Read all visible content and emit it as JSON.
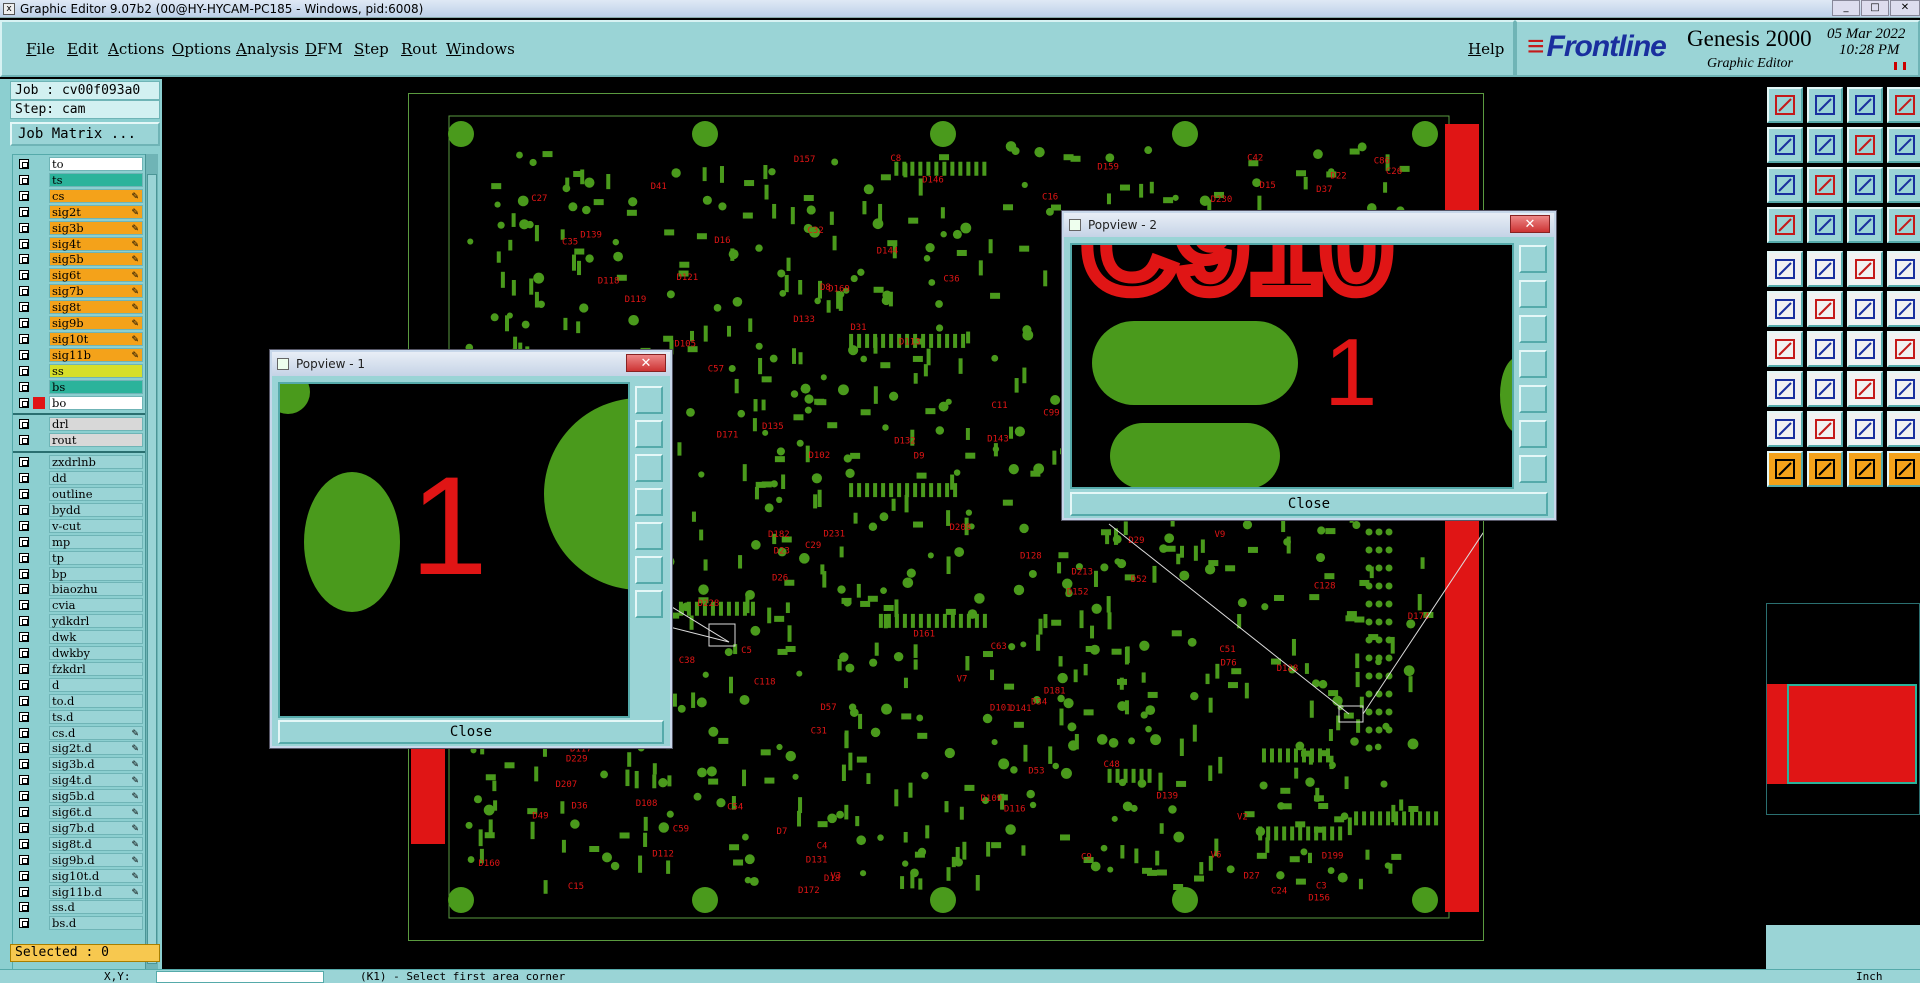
{
  "window": {
    "title": "Graphic Editor 9.07b2 (00@HY-HYCAM-PC185 - Windows, pid:6008)"
  },
  "menu": {
    "items": [
      "File",
      "Edit",
      "Actions",
      "Options",
      "Analysis",
      "DFM",
      "Step",
      "Rout",
      "Windows"
    ],
    "help": "Help"
  },
  "brand": {
    "logo": "Frontline",
    "product": "Genesis 2000",
    "subtitle": "Graphic Editor",
    "date": "05 Mar 2022",
    "time": "10:28 PM"
  },
  "job": {
    "job_line": "Job : cv00f093a0",
    "step_line": "Step: cam",
    "matrix_button": "Job Matrix ..."
  },
  "layers": [
    {
      "name": "to",
      "bg": "#ffffff",
      "lock": false,
      "mark": ""
    },
    {
      "name": "ts",
      "bg": "#2bb39b",
      "lock": false,
      "mark": ""
    },
    {
      "name": "cs",
      "bg": "#f4a21a",
      "lock": true,
      "mark": ""
    },
    {
      "name": "sig2t",
      "bg": "#f4a21a",
      "lock": true,
      "mark": ""
    },
    {
      "name": "sig3b",
      "bg": "#f4a21a",
      "lock": true,
      "mark": ""
    },
    {
      "name": "sig4t",
      "bg": "#f4a21a",
      "lock": true,
      "mark": ""
    },
    {
      "name": "sig5b",
      "bg": "#f4a21a",
      "lock": true,
      "mark": ""
    },
    {
      "name": "sig6t",
      "bg": "#f4a21a",
      "lock": true,
      "mark": ""
    },
    {
      "name": "sig7b",
      "bg": "#f4a21a",
      "lock": true,
      "mark": ""
    },
    {
      "name": "sig8t",
      "bg": "#f4a21a",
      "lock": true,
      "mark": ""
    },
    {
      "name": "sig9b",
      "bg": "#f4a21a",
      "lock": true,
      "mark": ""
    },
    {
      "name": "sig10t",
      "bg": "#f4a21a",
      "lock": true,
      "mark": ""
    },
    {
      "name": "sig11b",
      "bg": "#f4a21a",
      "lock": true,
      "mark": ""
    },
    {
      "name": "ss",
      "bg": "#d6df2a",
      "lock": false,
      "mark": ""
    },
    {
      "name": "bs",
      "bg": "#2bb39b",
      "lock": false,
      "mark": ""
    },
    {
      "name": "bo",
      "bg": "#ffffff",
      "lock": false,
      "mark": "red"
    },
    {
      "sep": true
    },
    {
      "name": "drl",
      "bg": "#d8d8d8",
      "lock": false,
      "mark": ""
    },
    {
      "name": "rout",
      "bg": "#d8d8d8",
      "lock": false,
      "mark": ""
    },
    {
      "sep": true
    },
    {
      "name": "zxdrlnb",
      "bg": "#9ad4d6",
      "lock": false,
      "mark": ""
    },
    {
      "name": "dd",
      "bg": "#9ad4d6",
      "lock": false,
      "mark": ""
    },
    {
      "name": "outline",
      "bg": "#9ad4d6",
      "lock": false,
      "mark": ""
    },
    {
      "name": "bydd",
      "bg": "#9ad4d6",
      "lock": false,
      "mark": ""
    },
    {
      "name": "v-cut",
      "bg": "#9ad4d6",
      "lock": false,
      "mark": ""
    },
    {
      "name": "mp",
      "bg": "#9ad4d6",
      "lock": false,
      "mark": ""
    },
    {
      "name": "tp",
      "bg": "#9ad4d6",
      "lock": false,
      "mark": ""
    },
    {
      "name": "bp",
      "bg": "#9ad4d6",
      "lock": false,
      "mark": ""
    },
    {
      "name": "biaozhu",
      "bg": "#9ad4d6",
      "lock": false,
      "mark": ""
    },
    {
      "name": "cvia",
      "bg": "#9ad4d6",
      "lock": false,
      "mark": ""
    },
    {
      "name": "ydkdrl",
      "bg": "#9ad4d6",
      "lock": false,
      "mark": ""
    },
    {
      "name": "dwk",
      "bg": "#9ad4d6",
      "lock": false,
      "mark": ""
    },
    {
      "name": "dwkby",
      "bg": "#9ad4d6",
      "lock": false,
      "mark": ""
    },
    {
      "name": "fzkdrl",
      "bg": "#9ad4d6",
      "lock": false,
      "mark": ""
    },
    {
      "name": "d",
      "bg": "#9ad4d6",
      "lock": false,
      "mark": ""
    },
    {
      "name": "to.d",
      "bg": "#9ad4d6",
      "lock": false,
      "mark": ""
    },
    {
      "name": "ts.d",
      "bg": "#9ad4d6",
      "lock": false,
      "mark": ""
    },
    {
      "name": "cs.d",
      "bg": "#9ad4d6",
      "lock": true,
      "mark": ""
    },
    {
      "name": "sig2t.d",
      "bg": "#9ad4d6",
      "lock": true,
      "mark": ""
    },
    {
      "name": "sig3b.d",
      "bg": "#9ad4d6",
      "lock": true,
      "mark": ""
    },
    {
      "name": "sig4t.d",
      "bg": "#9ad4d6",
      "lock": true,
      "mark": ""
    },
    {
      "name": "sig5b.d",
      "bg": "#9ad4d6",
      "lock": true,
      "mark": ""
    },
    {
      "name": "sig6t.d",
      "bg": "#9ad4d6",
      "lock": true,
      "mark": ""
    },
    {
      "name": "sig7b.d",
      "bg": "#9ad4d6",
      "lock": true,
      "mark": ""
    },
    {
      "name": "sig8t.d",
      "bg": "#9ad4d6",
      "lock": true,
      "mark": ""
    },
    {
      "name": "sig9b.d",
      "bg": "#9ad4d6",
      "lock": true,
      "mark": ""
    },
    {
      "name": "sig10t.d",
      "bg": "#9ad4d6",
      "lock": true,
      "mark": ""
    },
    {
      "name": "sig11b.d",
      "bg": "#9ad4d6",
      "lock": true,
      "mark": ""
    },
    {
      "name": "ss.d",
      "bg": "#9ad4d6",
      "lock": false,
      "mark": ""
    },
    {
      "name": "bs.d",
      "bg": "#9ad4d6",
      "lock": false,
      "mark": ""
    }
  ],
  "selected": "Selected : 0",
  "popview1": {
    "title": "Popview - 1",
    "close_label": "Close",
    "glyph": "1"
  },
  "popview2": {
    "title": "Popview - 2",
    "close_label": "Close",
    "glyph": "1",
    "partial_text": "C910"
  },
  "board": {
    "refdes_samples": [
      "C51",
      "D208",
      "D213",
      "D171",
      "D161",
      "D157",
      "D165",
      "D156",
      "D199",
      "D182",
      "D180",
      "D175",
      "D169",
      "D174",
      "D144",
      "D160",
      "D181",
      "D143",
      "D178",
      "D188",
      "D146",
      "D172",
      "D128",
      "D150",
      "D135",
      "D139",
      "D141",
      "D142",
      "C128",
      "C56",
      "C54",
      "C59",
      "C57",
      "C40",
      "C39",
      "C38",
      "C48",
      "C42",
      "C36",
      "C29",
      "C32",
      "C27",
      "C31",
      "C35",
      "C25",
      "C24",
      "C16",
      "C17",
      "C15",
      "C11",
      "C10",
      "C9",
      "C8",
      "C5",
      "D76",
      "D77",
      "D55",
      "D36",
      "D37",
      "D40",
      "D41",
      "D52",
      "D51",
      "D53",
      "D27",
      "D26",
      "D22",
      "D23",
      "D29",
      "D31",
      "D34",
      "D8",
      "D3",
      "D7",
      "D9",
      "D16",
      "D18",
      "D15",
      "D102",
      "D101",
      "D108",
      "D109",
      "D116",
      "D118",
      "D117",
      "D119",
      "D121",
      "D126",
      "D131",
      "D132",
      "D133",
      "D117",
      "V2",
      "V3",
      "V5",
      "V6",
      "V7",
      "V9",
      "C4",
      "C3",
      "C1",
      "C86",
      "C99",
      "C18",
      "C26",
      "C49",
      "D113",
      "D47",
      "D49",
      "D112",
      "D139",
      "D159",
      "D152",
      "D105",
      "D207",
      "C117",
      "C118",
      "D229",
      "D228",
      "D231",
      "D230",
      "C97",
      "D57",
      "C63"
    ],
    "pad_color": "#4a9a1c",
    "text_color": "#e01515",
    "frame_color": "#5a9a3f"
  },
  "status": {
    "prompt": "(K1) - Select first area corner",
    "coord_label": "X,Y:",
    "unit": "Inch"
  },
  "colors": {
    "panel": "#9ad4d6",
    "accent_orange": "#f4a21a",
    "copper_green": "#4a9a1c",
    "silk_red": "#e01515"
  }
}
